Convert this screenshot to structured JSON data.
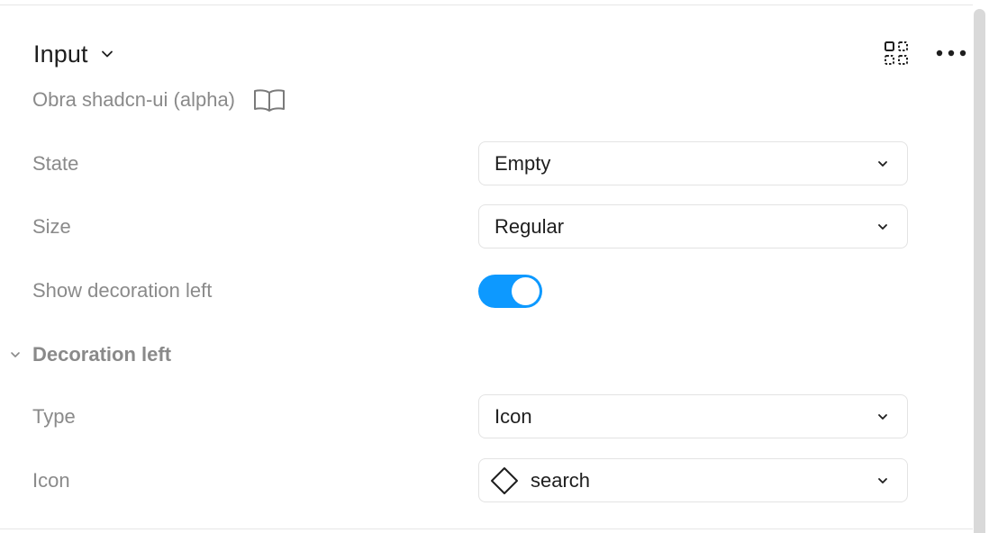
{
  "header": {
    "title": "Input",
    "library": "Obra shadcn-ui (alpha)",
    "icons": {
      "title_chevron": "chevron-down-icon",
      "select_instance": "select-matching-layers-icon",
      "more": "more-horizontal-icon",
      "library": "book-icon"
    }
  },
  "properties": [
    {
      "label": "State",
      "type": "dropdown",
      "value": "Empty"
    },
    {
      "label": "Size",
      "type": "dropdown",
      "value": "Regular"
    },
    {
      "label": "Show decoration left",
      "type": "toggle",
      "value": true
    }
  ],
  "section": {
    "title": "Decoration left",
    "expanded": true,
    "properties": [
      {
        "label": "Type",
        "type": "dropdown",
        "value": "Icon"
      },
      {
        "label": "Icon",
        "type": "instance-swap",
        "value": "search",
        "icon": "component-diamond-icon"
      }
    ]
  },
  "colors": {
    "accent": "#0d99ff",
    "label": "#8a8a8a",
    "text": "#1e1e1e",
    "border": "#e3e3e3"
  }
}
